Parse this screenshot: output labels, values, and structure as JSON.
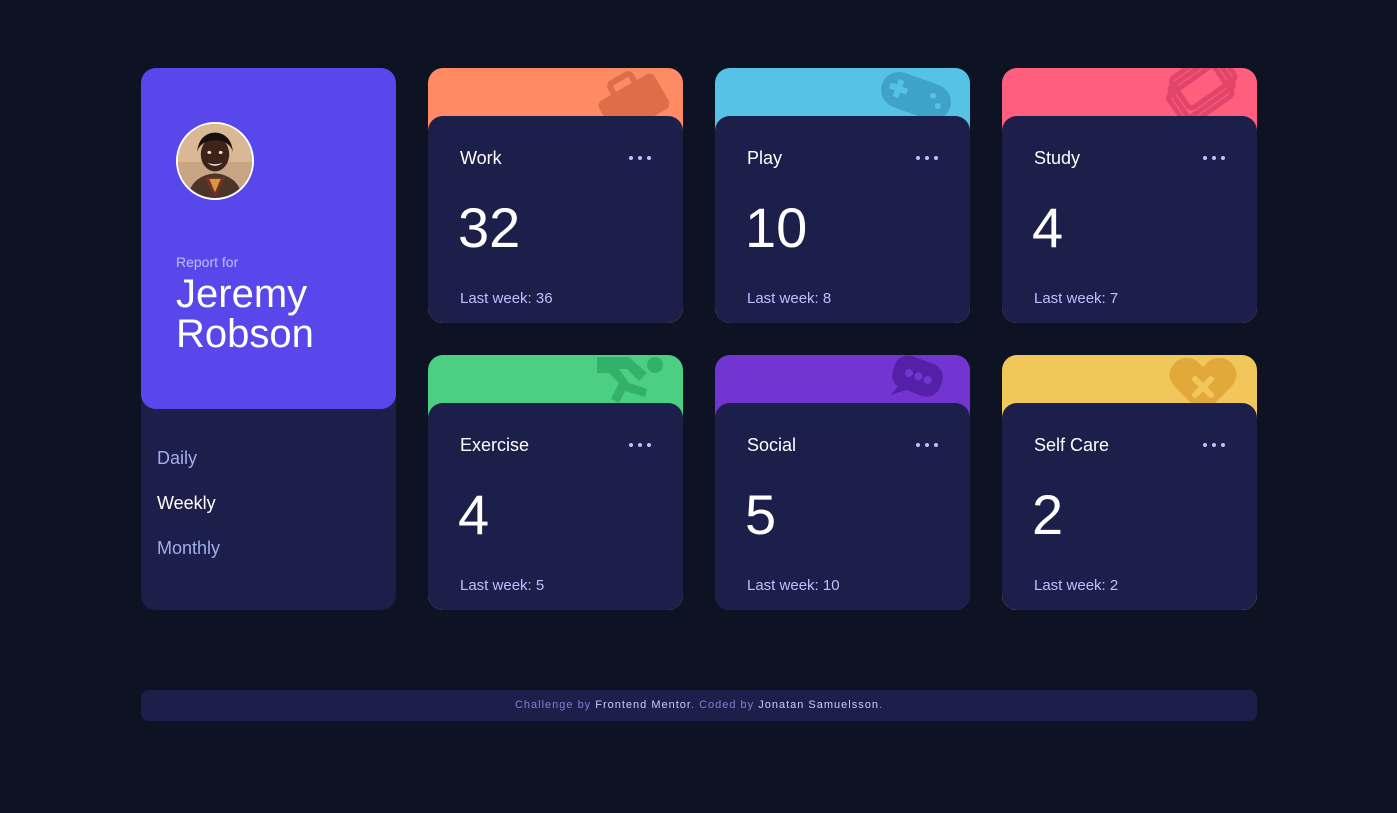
{
  "profile": {
    "report_label": "Report for",
    "user_name": "Jeremy Robson",
    "avatar_alt": "avatar"
  },
  "periods": [
    {
      "label": "Daily",
      "active": false
    },
    {
      "label": "Weekly",
      "active": true
    },
    {
      "label": "Monthly",
      "active": false
    }
  ],
  "activities": [
    {
      "title": "Work",
      "current": "32",
      "previous": "Last week: 36",
      "color": "#ff8b64",
      "icon": "briefcase-icon"
    },
    {
      "title": "Play",
      "current": "10",
      "previous": "Last week: 8",
      "color": "#55c2e6",
      "icon": "gamepad-icon"
    },
    {
      "title": "Study",
      "current": "4",
      "previous": "Last week: 7",
      "color": "#ff5e7d",
      "icon": "books-icon"
    },
    {
      "title": "Exercise",
      "current": "4",
      "previous": "Last week: 5",
      "color": "#4bcf82",
      "icon": "running-icon"
    },
    {
      "title": "Social",
      "current": "5",
      "previous": "Last week: 10",
      "color": "#7235d1",
      "icon": "chat-icon"
    },
    {
      "title": "Self Care",
      "current": "2",
      "previous": "Last week: 2",
      "color": "#f1c75b",
      "icon": "heart-icon"
    }
  ],
  "footer": {
    "prefix": "Challenge by ",
    "challenge_link": "Frontend Mentor",
    "middle": ". Coded by ",
    "author_link": "Jonatan Samuelsson",
    "suffix": "."
  }
}
